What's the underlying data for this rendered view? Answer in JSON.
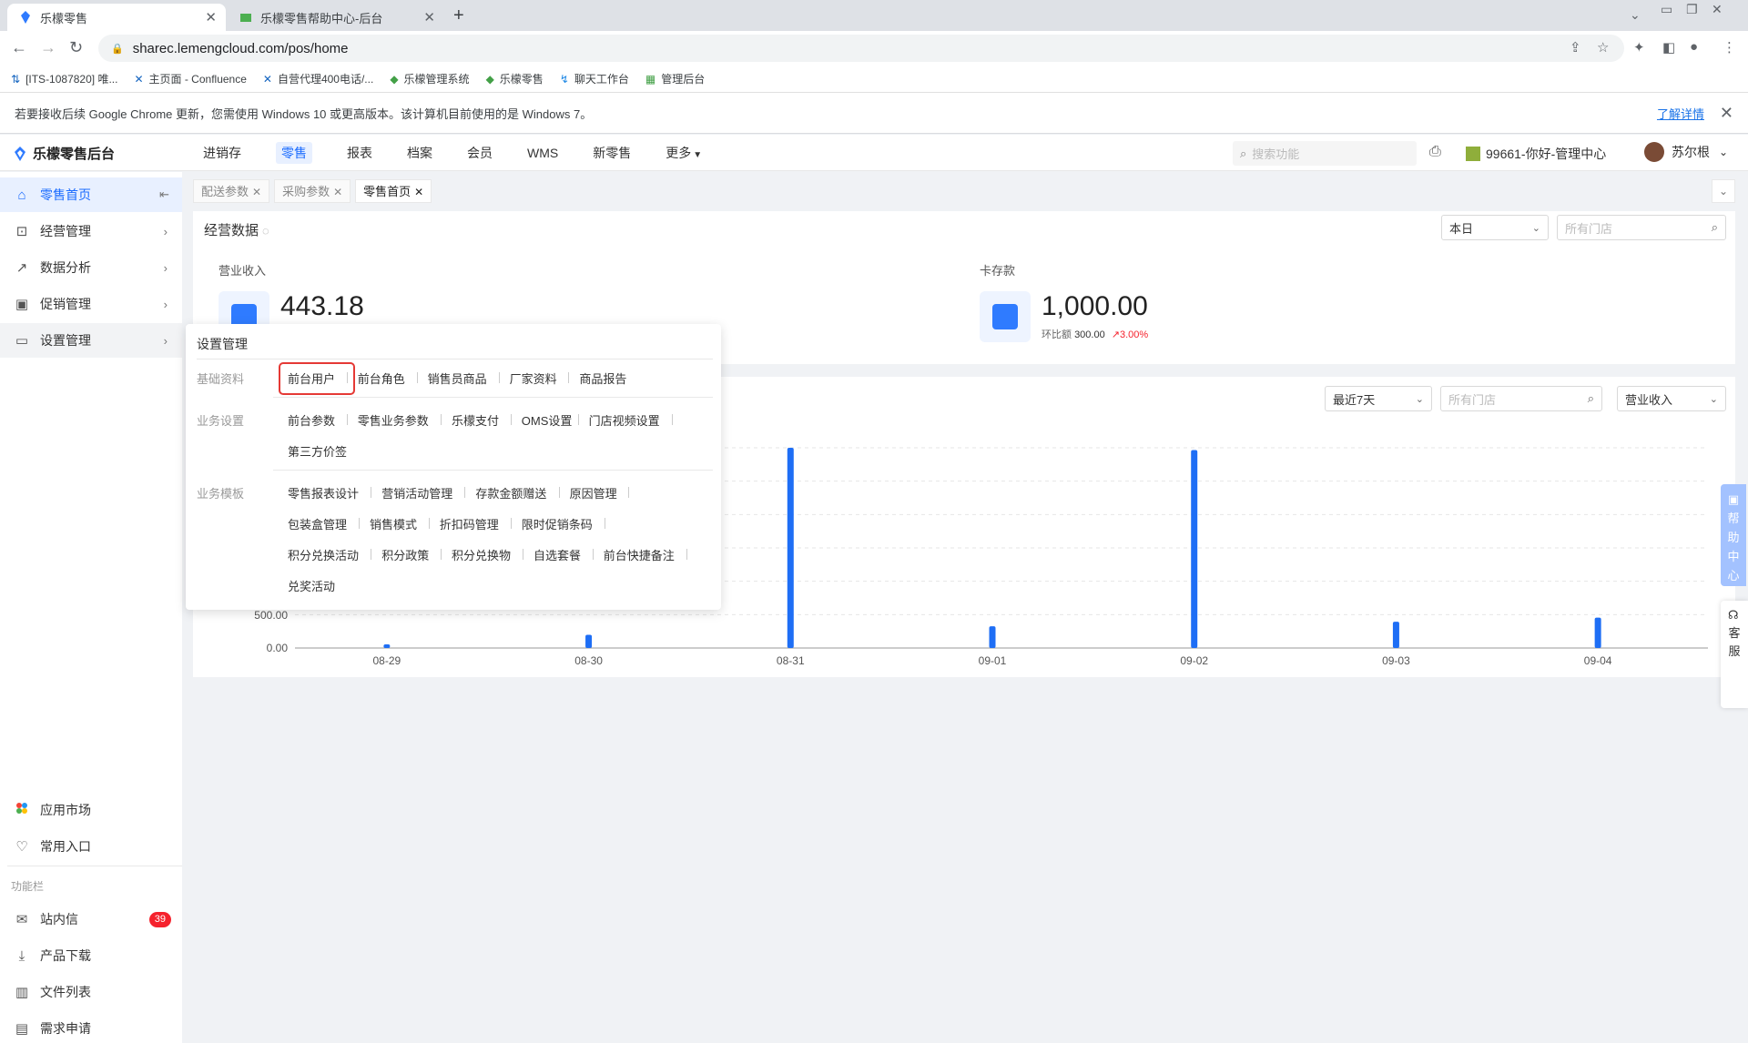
{
  "browser": {
    "tabs": [
      {
        "title": "乐檬零售",
        "active": true
      },
      {
        "title": "乐檬零售帮助中心-后台",
        "active": false
      }
    ],
    "url": "sharec.lemengcloud.com/pos/home",
    "bookmarks": [
      "[ITS-1087820] 唯...",
      "主页面 - Confluence",
      "自营代理400电话/...",
      "乐檬管理系统",
      "乐檬零售",
      "聊天工作台",
      "管理后台"
    ],
    "infobar": {
      "message": "若要接收后续 Google Chrome 更新，您需使用 Windows 10 或更高版本。该计算机目前使用的是 Windows 7。",
      "link": "了解详情"
    }
  },
  "header": {
    "brand": "乐檬零售后台",
    "nav": [
      "进销存",
      "零售",
      "报表",
      "档案",
      "会员",
      "WMS",
      "新零售",
      "更多"
    ],
    "active_nav": "零售",
    "search_placeholder": "搜索功能",
    "store": "99661-你好-管理中心",
    "user": "苏尔根"
  },
  "sidebar": {
    "items": [
      {
        "label": "零售首页",
        "icon": "home-icon"
      },
      {
        "label": "经营管理",
        "icon": "chart-line-icon"
      },
      {
        "label": "数据分析",
        "icon": "analytics-icon"
      },
      {
        "label": "促销管理",
        "icon": "promotion-icon"
      },
      {
        "label": "设置管理",
        "icon": "folder-icon"
      }
    ],
    "bottom": [
      {
        "label": "应用市场",
        "icon": "app-market-icon"
      },
      {
        "label": "常用入口",
        "icon": "heart-icon"
      }
    ],
    "group_title": "功能栏",
    "func": [
      {
        "label": "站内信",
        "icon": "mail-icon",
        "badge": "39"
      },
      {
        "label": "产品下载",
        "icon": "download-icon"
      },
      {
        "label": "文件列表",
        "icon": "file-list-icon"
      },
      {
        "label": "需求申请",
        "icon": "request-icon"
      }
    ]
  },
  "content_tabs": [
    {
      "label": "配送参数",
      "active": false
    },
    {
      "label": "采购参数",
      "active": false
    },
    {
      "label": "零售首页",
      "active": true
    }
  ],
  "overview": {
    "title": "经营数据",
    "period": "本日",
    "store_placeholder": "所有门店",
    "revenue": {
      "label": "营业收入",
      "value": "443.18"
    },
    "card_deposit": {
      "label": "卡存款",
      "value": "1,000.00",
      "compare_label": "环比额",
      "compare_value": "300.00",
      "change": "3.00%"
    }
  },
  "trend": {
    "period": "最近7天",
    "store_placeholder": "所有门店",
    "metric": "营业收入"
  },
  "chart_data": {
    "type": "bar",
    "categories": [
      "08-29",
      "08-30",
      "08-31",
      "09-01",
      "09-02",
      "09-03",
      "09-04"
    ],
    "values": [
      20,
      230,
      3500,
      380,
      3460,
      460,
      530
    ],
    "yticks_visible": [
      "500.00",
      "0.00"
    ],
    "ylim": [
      0,
      3500
    ],
    "grid": true
  },
  "menu": {
    "title": "设置管理",
    "sections": [
      {
        "name": "基础资料",
        "rows": [
          [
            "前台用户",
            "前台角色",
            "销售员商品",
            "厂家资料",
            "商品报告"
          ]
        ]
      },
      {
        "name": "业务设置",
        "rows": [
          [
            "前台参数",
            "零售业务参数",
            "乐檬支付",
            "OMS设置",
            "门店视频设置"
          ],
          [
            "第三方价签"
          ]
        ]
      },
      {
        "name": "业务模板",
        "rows": [
          [
            "零售报表设计",
            "营销活动管理",
            "存款金额赠送",
            "原因管理"
          ],
          [
            "包装盒管理",
            "销售模式",
            "折扣码管理",
            "限时促销条码"
          ],
          [
            "积分兑换活动",
            "积分政策",
            "积分兑换物",
            "自选套餐",
            "前台快捷备注"
          ],
          [
            "兑奖活动"
          ]
        ]
      }
    ],
    "highlighted": "前台用户"
  },
  "floating": {
    "help": [
      "帮",
      "助",
      "中",
      "心"
    ],
    "service": [
      "客",
      "服"
    ]
  },
  "colors": {
    "accent": "#1a6bff",
    "bar": "#1e6ef5",
    "badge": "#f5222d",
    "highlight": "#e53935"
  }
}
